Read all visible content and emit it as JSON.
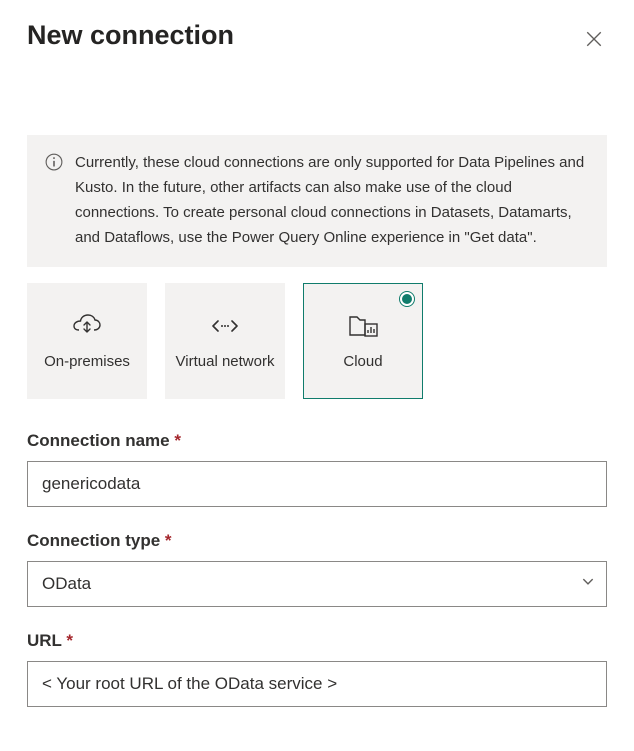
{
  "header": {
    "title": "New connection"
  },
  "info": {
    "text": "Currently, these cloud connections are only supported for Data Pipelines and Kusto. In the future, other artifacts can also make use of the cloud connections. To create personal cloud connections in Datasets, Datamarts, and Dataflows, use the Power Query Online experience in \"Get data\"."
  },
  "tiles": {
    "onprem": {
      "label": "On-premises"
    },
    "vnet": {
      "label": "Virtual network"
    },
    "cloud": {
      "label": "Cloud"
    }
  },
  "fields": {
    "connection_name": {
      "label": "Connection name",
      "value": "genericodata"
    },
    "connection_type": {
      "label": "Connection type",
      "value": "OData"
    },
    "url": {
      "label": "URL",
      "value": "< Your root URL of the OData service >"
    }
  }
}
